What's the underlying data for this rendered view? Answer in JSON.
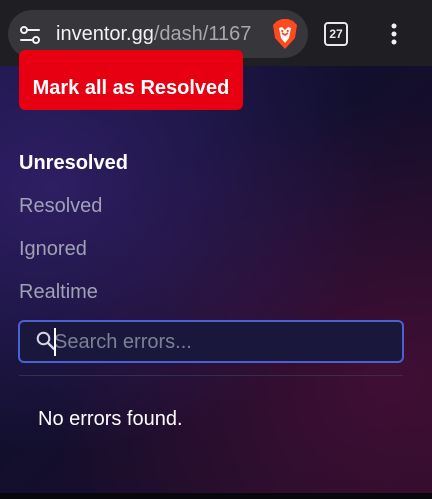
{
  "browser": {
    "url_domain": "inventor.gg",
    "url_path": "/dash/1167",
    "tab_count": "27",
    "icons": {
      "site_settings": "site-settings-icon",
      "brand": "brave-lion-icon",
      "menu": "vertical-ellipsis-icon"
    }
  },
  "page": {
    "mark_resolved_label": "Mark all as Resolved",
    "filters": [
      {
        "label": "Unresolved",
        "active": true
      },
      {
        "label": "Resolved",
        "active": false
      },
      {
        "label": "Ignored",
        "active": false
      },
      {
        "label": "Realtime",
        "active": false
      }
    ],
    "search": {
      "placeholder": "Search errors...",
      "value": ""
    },
    "empty_state": "No errors found."
  },
  "colors": {
    "accent_red": "#e60012",
    "search_border": "#4b61cf",
    "active_text": "#ffffff",
    "inactive_text": "#9fa1b4"
  }
}
